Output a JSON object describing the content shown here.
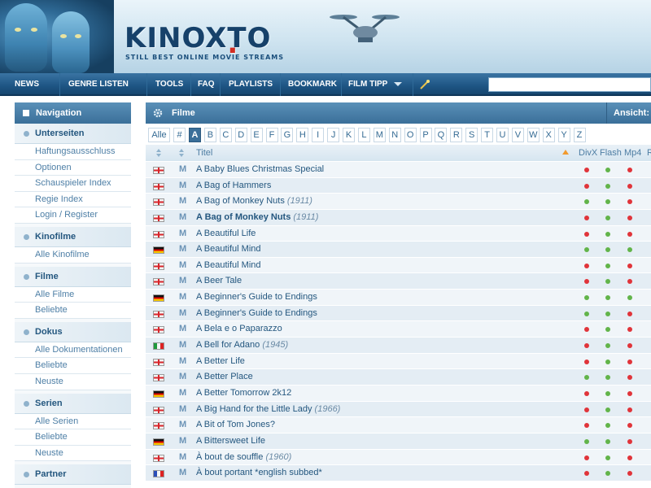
{
  "header": {
    "logo_text_a": "KINOX",
    "logo_dot": ".",
    "logo_text_b": "TO",
    "slogan": "STILL BEST ONLINE MOVIE STREAMS"
  },
  "nav": {
    "items": [
      {
        "label": "NEWS",
        "dropdown": true
      },
      {
        "label": "GENRE LISTEN",
        "dropdown": true
      },
      {
        "label": "TOOLS",
        "dropdown": false
      },
      {
        "label": "FAQ",
        "dropdown": false
      },
      {
        "label": "PLAYLISTS",
        "dropdown": false
      },
      {
        "label": "BOOKMARK",
        "dropdown": false
      },
      {
        "label": "FILM TIPP",
        "dropdown": true
      }
    ],
    "search_value": ""
  },
  "sidebar": {
    "title": "Navigation",
    "groups": [
      {
        "label": "Unterseiten",
        "links": [
          "Haftungsausschluss",
          "Optionen",
          "Schauspieler Index",
          "Regie Index",
          "Login / Register"
        ]
      },
      {
        "label": "Kinofilme",
        "links": [
          "Alle Kinofilme"
        ]
      },
      {
        "label": "Filme",
        "links": [
          "Alle Filme",
          "Beliebte"
        ]
      },
      {
        "label": "Dokus",
        "links": [
          "Alle Dokumentationen",
          "Beliebte",
          "Neuste"
        ]
      },
      {
        "label": "Serien",
        "links": [
          "Alle Serien",
          "Beliebte",
          "Neuste"
        ]
      },
      {
        "label": "Partner",
        "links": []
      }
    ]
  },
  "main": {
    "title": "Filme",
    "ansicht": "Ansicht:",
    "letters": [
      "Alle",
      "#",
      "A",
      "B",
      "C",
      "D",
      "E",
      "F",
      "G",
      "H",
      "I",
      "J",
      "K",
      "L",
      "M",
      "N",
      "O",
      "P",
      "Q",
      "R",
      "S",
      "T",
      "U",
      "V",
      "W",
      "X",
      "Y",
      "Z"
    ],
    "active_letter": "A",
    "columns": {
      "title": "Titel",
      "divx": "DivX",
      "flash": "Flash",
      "mp4": "Mp4",
      "extra": "R"
    },
    "rows": [
      {
        "flag": "en",
        "tag": "M",
        "title": "A Baby Blues Christmas Special",
        "year": "",
        "bold": false,
        "divx": "r",
        "flash": "g",
        "mp4": "r"
      },
      {
        "flag": "en",
        "tag": "M",
        "title": "A Bag of Hammers",
        "year": "",
        "bold": false,
        "divx": "r",
        "flash": "g",
        "mp4": "r"
      },
      {
        "flag": "en",
        "tag": "M",
        "title": "A Bag of Monkey Nuts",
        "year": "(1911)",
        "bold": false,
        "divx": "g",
        "flash": "g",
        "mp4": "r"
      },
      {
        "flag": "en",
        "tag": "M",
        "title": "A Bag of Monkey Nuts",
        "year": "(1911)",
        "bold": true,
        "divx": "r",
        "flash": "g",
        "mp4": "r"
      },
      {
        "flag": "en",
        "tag": "M",
        "title": "A Beautiful Life",
        "year": "",
        "bold": false,
        "divx": "r",
        "flash": "g",
        "mp4": "r"
      },
      {
        "flag": "de",
        "tag": "M",
        "title": "A Beautiful Mind",
        "year": "",
        "bold": false,
        "divx": "g",
        "flash": "g",
        "mp4": "g"
      },
      {
        "flag": "en",
        "tag": "M",
        "title": "A Beautiful Mind",
        "year": "",
        "bold": false,
        "divx": "r",
        "flash": "g",
        "mp4": "r"
      },
      {
        "flag": "en",
        "tag": "M",
        "title": "A Beer Tale",
        "year": "",
        "bold": false,
        "divx": "r",
        "flash": "g",
        "mp4": "r"
      },
      {
        "flag": "de",
        "tag": "M",
        "title": "A Beginner's Guide to Endings",
        "year": "",
        "bold": false,
        "divx": "g",
        "flash": "g",
        "mp4": "g"
      },
      {
        "flag": "en",
        "tag": "M",
        "title": "A Beginner's Guide to Endings",
        "year": "",
        "bold": false,
        "divx": "g",
        "flash": "g",
        "mp4": "r"
      },
      {
        "flag": "en",
        "tag": "M",
        "title": "A Bela e o Paparazzo",
        "year": "",
        "bold": false,
        "divx": "r",
        "flash": "g",
        "mp4": "r"
      },
      {
        "flag": "it",
        "tag": "M",
        "title": "A Bell for Adano",
        "year": "(1945)",
        "bold": false,
        "divx": "r",
        "flash": "g",
        "mp4": "r"
      },
      {
        "flag": "en",
        "tag": "M",
        "title": "A Better Life",
        "year": "",
        "bold": false,
        "divx": "r",
        "flash": "g",
        "mp4": "r"
      },
      {
        "flag": "en",
        "tag": "M",
        "title": "A Better Place",
        "year": "",
        "bold": false,
        "divx": "g",
        "flash": "g",
        "mp4": "r"
      },
      {
        "flag": "de",
        "tag": "M",
        "title": "A Better Tomorrow 2k12",
        "year": "",
        "bold": false,
        "divx": "r",
        "flash": "g",
        "mp4": "r"
      },
      {
        "flag": "en",
        "tag": "M",
        "title": "A Big Hand for the Little Lady",
        "year": "(1966)",
        "bold": false,
        "divx": "r",
        "flash": "g",
        "mp4": "r"
      },
      {
        "flag": "en",
        "tag": "M",
        "title": "A Bit of Tom Jones?",
        "year": "",
        "bold": false,
        "divx": "r",
        "flash": "g",
        "mp4": "r"
      },
      {
        "flag": "de",
        "tag": "M",
        "title": "A Bittersweet Life",
        "year": "",
        "bold": false,
        "divx": "g",
        "flash": "g",
        "mp4": "r"
      },
      {
        "flag": "en",
        "tag": "M",
        "title": "À bout de souffle",
        "year": "(1960)",
        "bold": false,
        "divx": "r",
        "flash": "g",
        "mp4": "r"
      },
      {
        "flag": "fr",
        "tag": "M",
        "title": "À bout portant *english subbed*",
        "year": "",
        "bold": false,
        "divx": "r",
        "flash": "g",
        "mp4": "r"
      }
    ]
  }
}
